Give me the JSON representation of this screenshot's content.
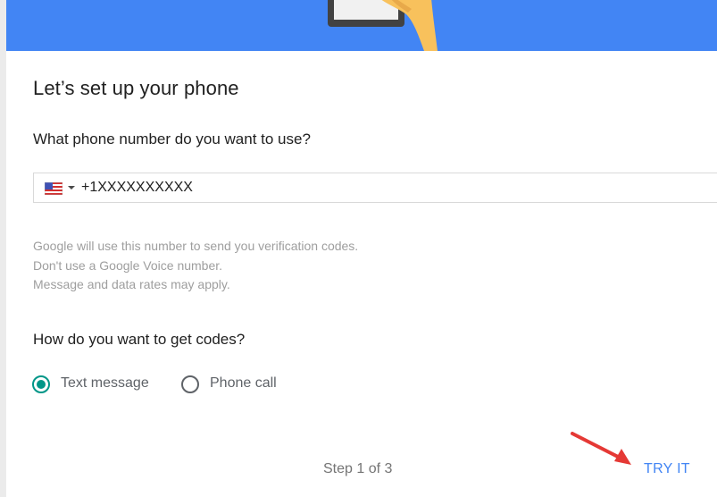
{
  "header": {
    "title": "Let’s set up your phone",
    "accent_color": "#4285f4"
  },
  "phone": {
    "question": "What phone number do you want to use?",
    "country_flag": "us-flag-icon",
    "value": "+1XXXXXXXXXX",
    "help_lines": [
      "Google will use this number to send you verification codes.",
      "Don't use a Google Voice number.",
      "Message and data rates may apply."
    ]
  },
  "delivery": {
    "question": "How do you want to get codes?",
    "options": [
      {
        "label": "Text message",
        "selected": true
      },
      {
        "label": "Phone call",
        "selected": false
      }
    ],
    "selected_color": "#009688"
  },
  "footer": {
    "step": "Step 1 of 3",
    "action": "TRY IT",
    "annotation_color": "#e53935"
  }
}
